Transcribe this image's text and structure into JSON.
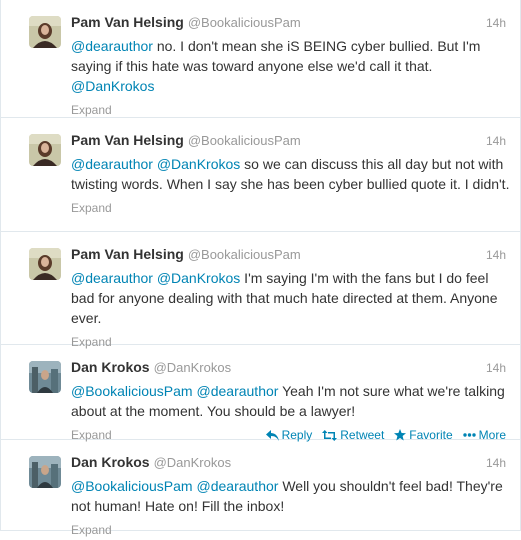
{
  "tweets": [
    {
      "fullname": "Pam Van Helsing",
      "username": "@BookaliciousPam",
      "time": "14h",
      "parts": [
        {
          "t": "@dearauthor",
          "m": true
        },
        {
          "t": " no. I don't mean she iS BEING cyber bullied. But I'm saying if this hate was toward anyone else we'd call it that. ",
          "m": false
        },
        {
          "t": "@DanKrokos",
          "m": true
        }
      ],
      "expand": "Expand"
    },
    {
      "fullname": "Pam Van Helsing",
      "username": "@BookaliciousPam",
      "time": "14h",
      "parts": [
        {
          "t": "@dearauthor",
          "m": true
        },
        {
          "t": " ",
          "m": false
        },
        {
          "t": "@DanKrokos",
          "m": true
        },
        {
          "t": " so we can discuss this all day but not with twisting words. When I say she has been cyber bullied quote it. I didn't.",
          "m": false
        }
      ],
      "expand": "Expand"
    },
    {
      "fullname": "Pam Van Helsing",
      "username": "@BookaliciousPam",
      "time": "14h",
      "parts": [
        {
          "t": "@dearauthor",
          "m": true
        },
        {
          "t": " ",
          "m": false
        },
        {
          "t": "@DanKrokos",
          "m": true
        },
        {
          "t": " I'm saying I'm with the fans but I do feel bad for anyone dealing with that much hate directed at them. Anyone ever.",
          "m": false
        }
      ],
      "expand": "Expand"
    },
    {
      "fullname": "Dan Krokos",
      "username": "@DanKrokos",
      "time": "14h",
      "parts": [
        {
          "t": "@BookaliciousPam",
          "m": true
        },
        {
          "t": " ",
          "m": false
        },
        {
          "t": "@dearauthor",
          "m": true
        },
        {
          "t": " Yeah I'm not sure what we're talking about at the moment. You should be a lawyer!",
          "m": false
        }
      ],
      "expand": "Expand",
      "actions": {
        "reply": "Reply",
        "retweet": "Retweet",
        "favorite": "Favorite",
        "more": "More"
      }
    },
    {
      "fullname": "Dan Krokos",
      "username": "@DanKrokos",
      "time": "14h",
      "parts": [
        {
          "t": "@BookaliciousPam",
          "m": true
        },
        {
          "t": " ",
          "m": false
        },
        {
          "t": "@dearauthor",
          "m": true
        },
        {
          "t": " Well you shouldn't feel bad! They're not human! Hate on! Fill the inbox!",
          "m": false
        }
      ],
      "expand": "Expand"
    }
  ],
  "colors": {
    "link": "#0084b4",
    "name": "#333333",
    "muted": "#999999",
    "border": "#e1e8ed"
  },
  "icons": {
    "reply": "reply-arrow-icon",
    "retweet": "retweet-icon",
    "favorite": "star-icon",
    "more": "more-dots-icon"
  }
}
